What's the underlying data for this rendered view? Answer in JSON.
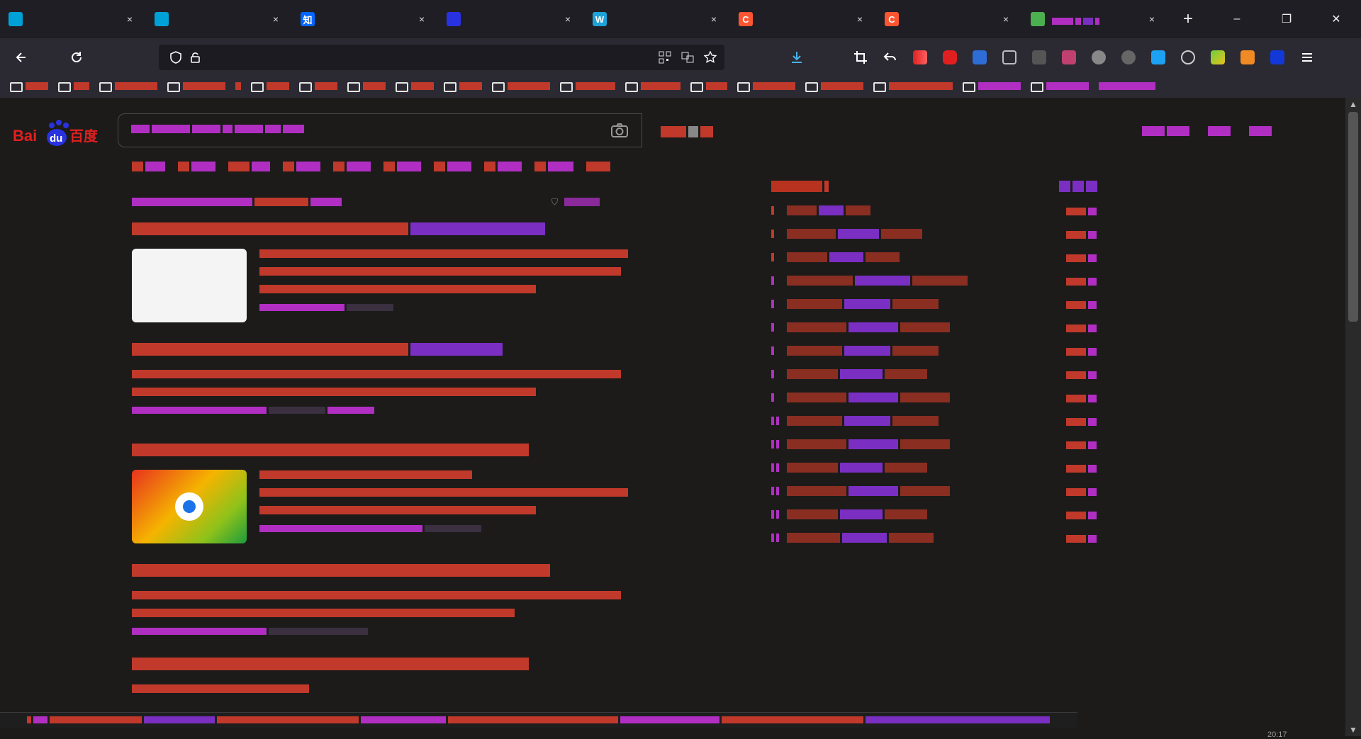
{
  "tabs": [
    {
      "favicon": "bilibili-icon",
      "color": "#00a1d6",
      "close": "×"
    },
    {
      "favicon": "bilibili-icon",
      "color": "#00a1d6",
      "close": "×"
    },
    {
      "favicon": "zhihu-icon",
      "glyph": "知",
      "color": "#0066ff",
      "close": "×"
    },
    {
      "favicon": "baidu-paw-icon",
      "color": "#2932e1",
      "close": "×"
    },
    {
      "favicon": "w-icon",
      "glyph": "W",
      "color": "#1ea3d8",
      "close": "×"
    },
    {
      "favicon": "csdn-icon",
      "glyph": "C",
      "color": "#fc5531",
      "close": "×"
    },
    {
      "favicon": "csdn-icon",
      "glyph": "C",
      "color": "#fc5531",
      "close": "×"
    },
    {
      "favicon": "chrome-ext-icon",
      "color": "#4caf50",
      "close": "×"
    }
  ],
  "window": {
    "minimize": "–",
    "restore": "❐",
    "close": "✕",
    "new_tab": "+"
  },
  "urlbar": {
    "value": ""
  },
  "search": {
    "logo_text": "Bai",
    "logo_text2": "du",
    "logo_cn": "百度"
  },
  "statusbar": {
    "time": "20:17"
  }
}
